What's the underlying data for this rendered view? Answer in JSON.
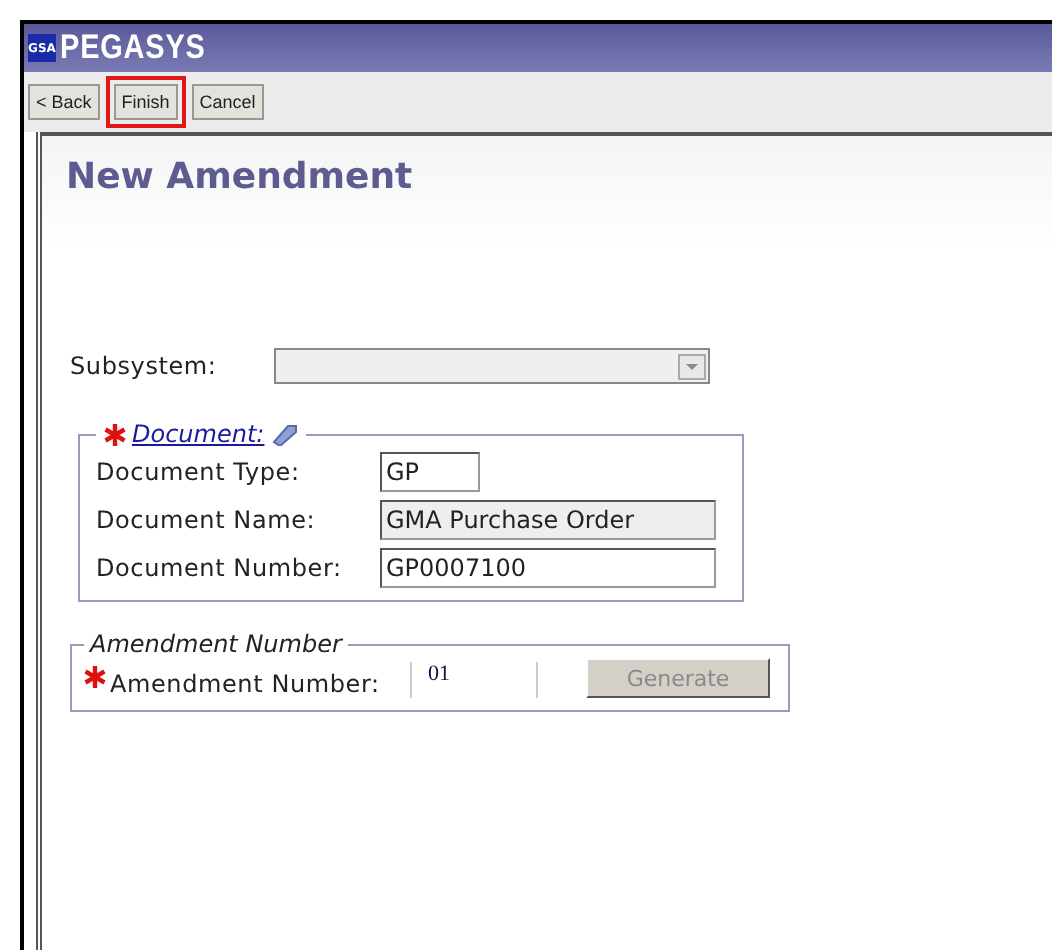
{
  "app": {
    "logo_badge": "GSA",
    "title": "PEGASYS"
  },
  "toolbar": [
    {
      "label": "< Back",
      "highlighted": false
    },
    {
      "label": "Finish",
      "highlighted": true
    },
    {
      "label": "Cancel",
      "highlighted": false
    }
  ],
  "heading": "New Amendment",
  "subsystem": {
    "label": "Subsystem:",
    "disabled": true
  },
  "document": {
    "legend": "Document:",
    "required": true,
    "fields": [
      {
        "label": "Document Type:",
        "value": "GP",
        "kind": "short",
        "readonly": false
      },
      {
        "label": "Document Name:",
        "value": "GMA Purchase Order",
        "kind": "long",
        "readonly": true
      },
      {
        "label": "Document Number:",
        "value": "GP0007100",
        "kind": "long",
        "readonly": false
      }
    ]
  },
  "amendment": {
    "legend": "Amendment Number",
    "label": "Amendment Number:",
    "required": true,
    "value": "01",
    "button": {
      "label": "Generate",
      "disabled": true
    }
  }
}
